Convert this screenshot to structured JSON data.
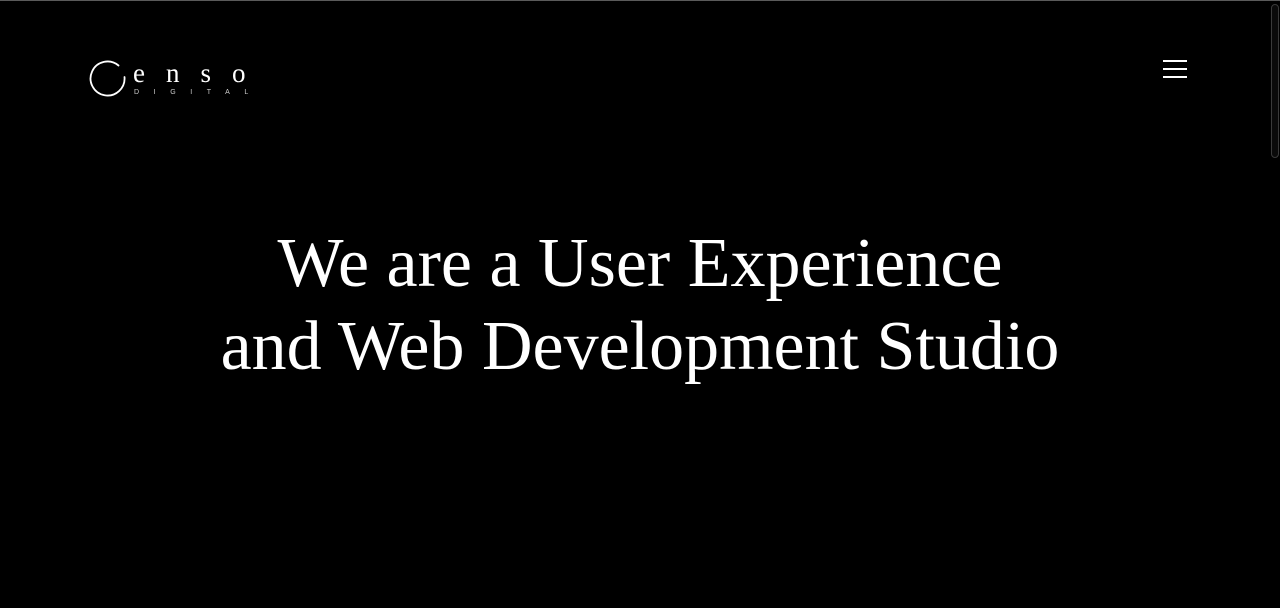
{
  "header": {
    "logo": {
      "wordmark": "enso",
      "subtitle": "DIGITAL",
      "icon": "enso-circle-icon"
    },
    "menu_icon": "hamburger-menu-icon"
  },
  "hero": {
    "line1": "We are a User Experience",
    "line2": "and Web Development Studio"
  },
  "colors": {
    "background": "#000000",
    "text": "#ffffff"
  }
}
